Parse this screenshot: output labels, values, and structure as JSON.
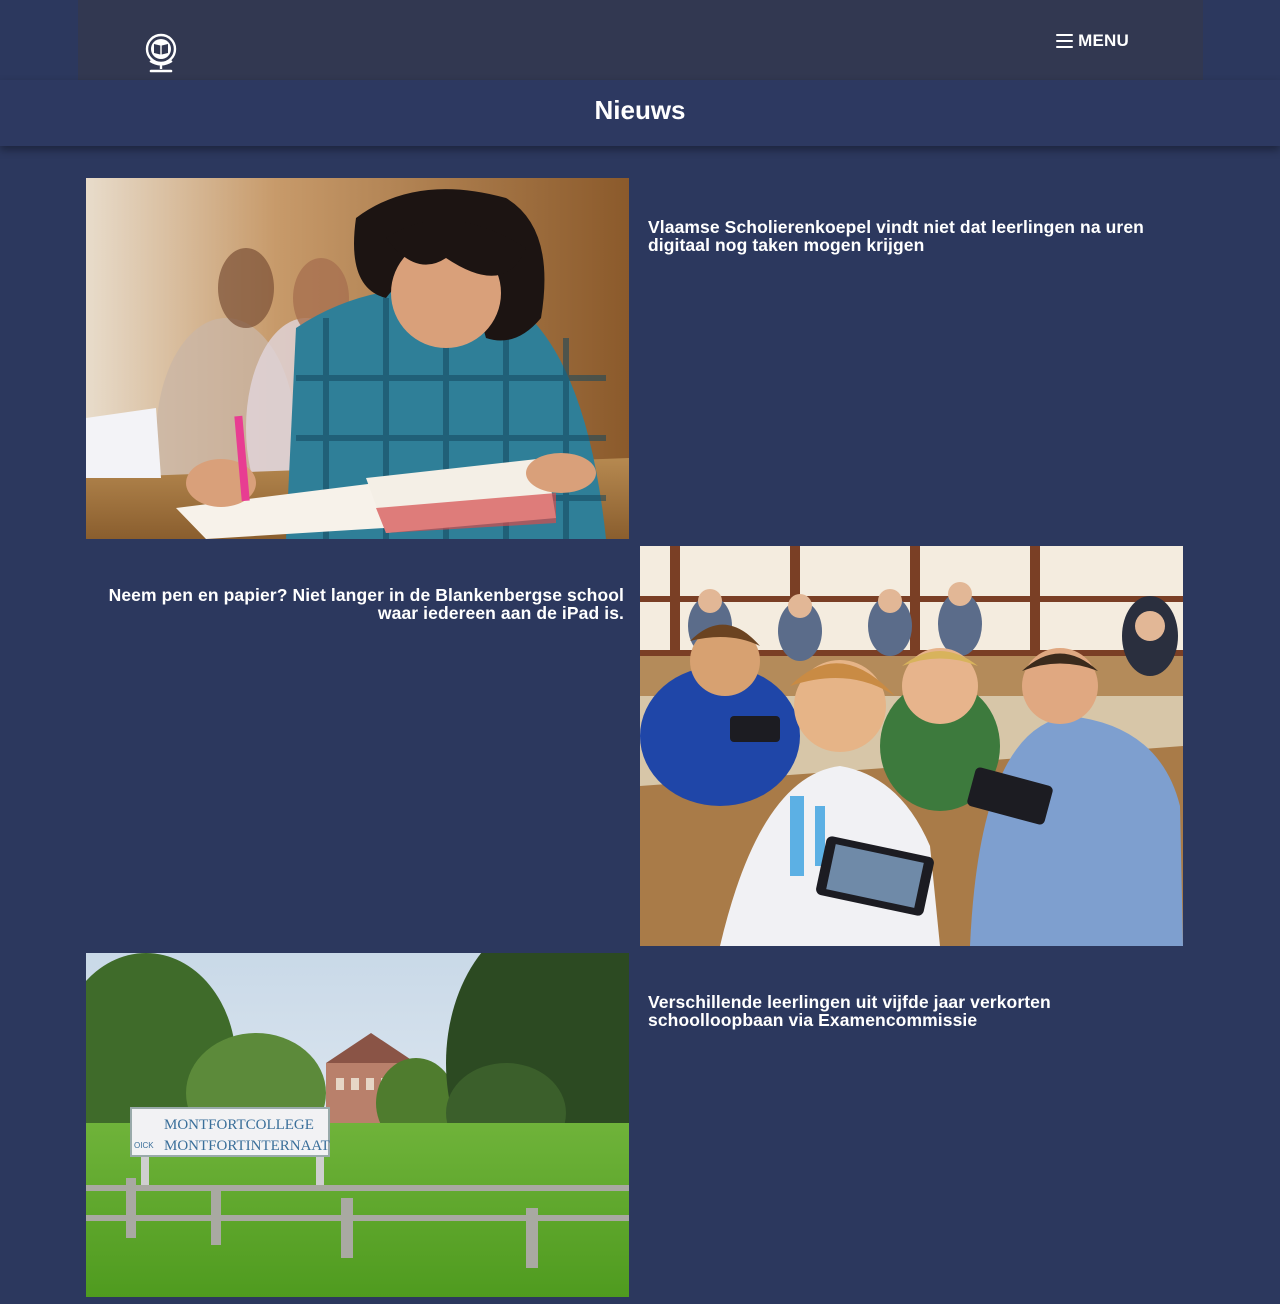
{
  "header": {
    "logo_icon": "globe-book-icon",
    "menu_icon": "hamburger-icon",
    "menu_label": "MENU"
  },
  "page": {
    "title": "Nieuws"
  },
  "news": [
    {
      "headline": "Vlaamse Scholierenkoepel vindt niet dat leerlingen na uren digitaal nog taken mogen krijgen",
      "image": "student-writing-photo"
    },
    {
      "headline": "Neem pen en papier? Niet langer in de Blankenbergse school waar iedereen aan de iPad is.",
      "image": "classroom-ipad-photo"
    },
    {
      "headline": "Verschillende leerlingen uit vijfde jaar verkorten schoolloopbaan via Examencommissie",
      "image": "montfortcollege-sign-photo",
      "image_text": [
        "MONTFORTCOLLEGE",
        "MONTFORTINTERNAAT",
        "OICK"
      ]
    }
  ],
  "colors": {
    "background": "#2c385e",
    "topbar": "#323851",
    "text": "#ffffff"
  }
}
